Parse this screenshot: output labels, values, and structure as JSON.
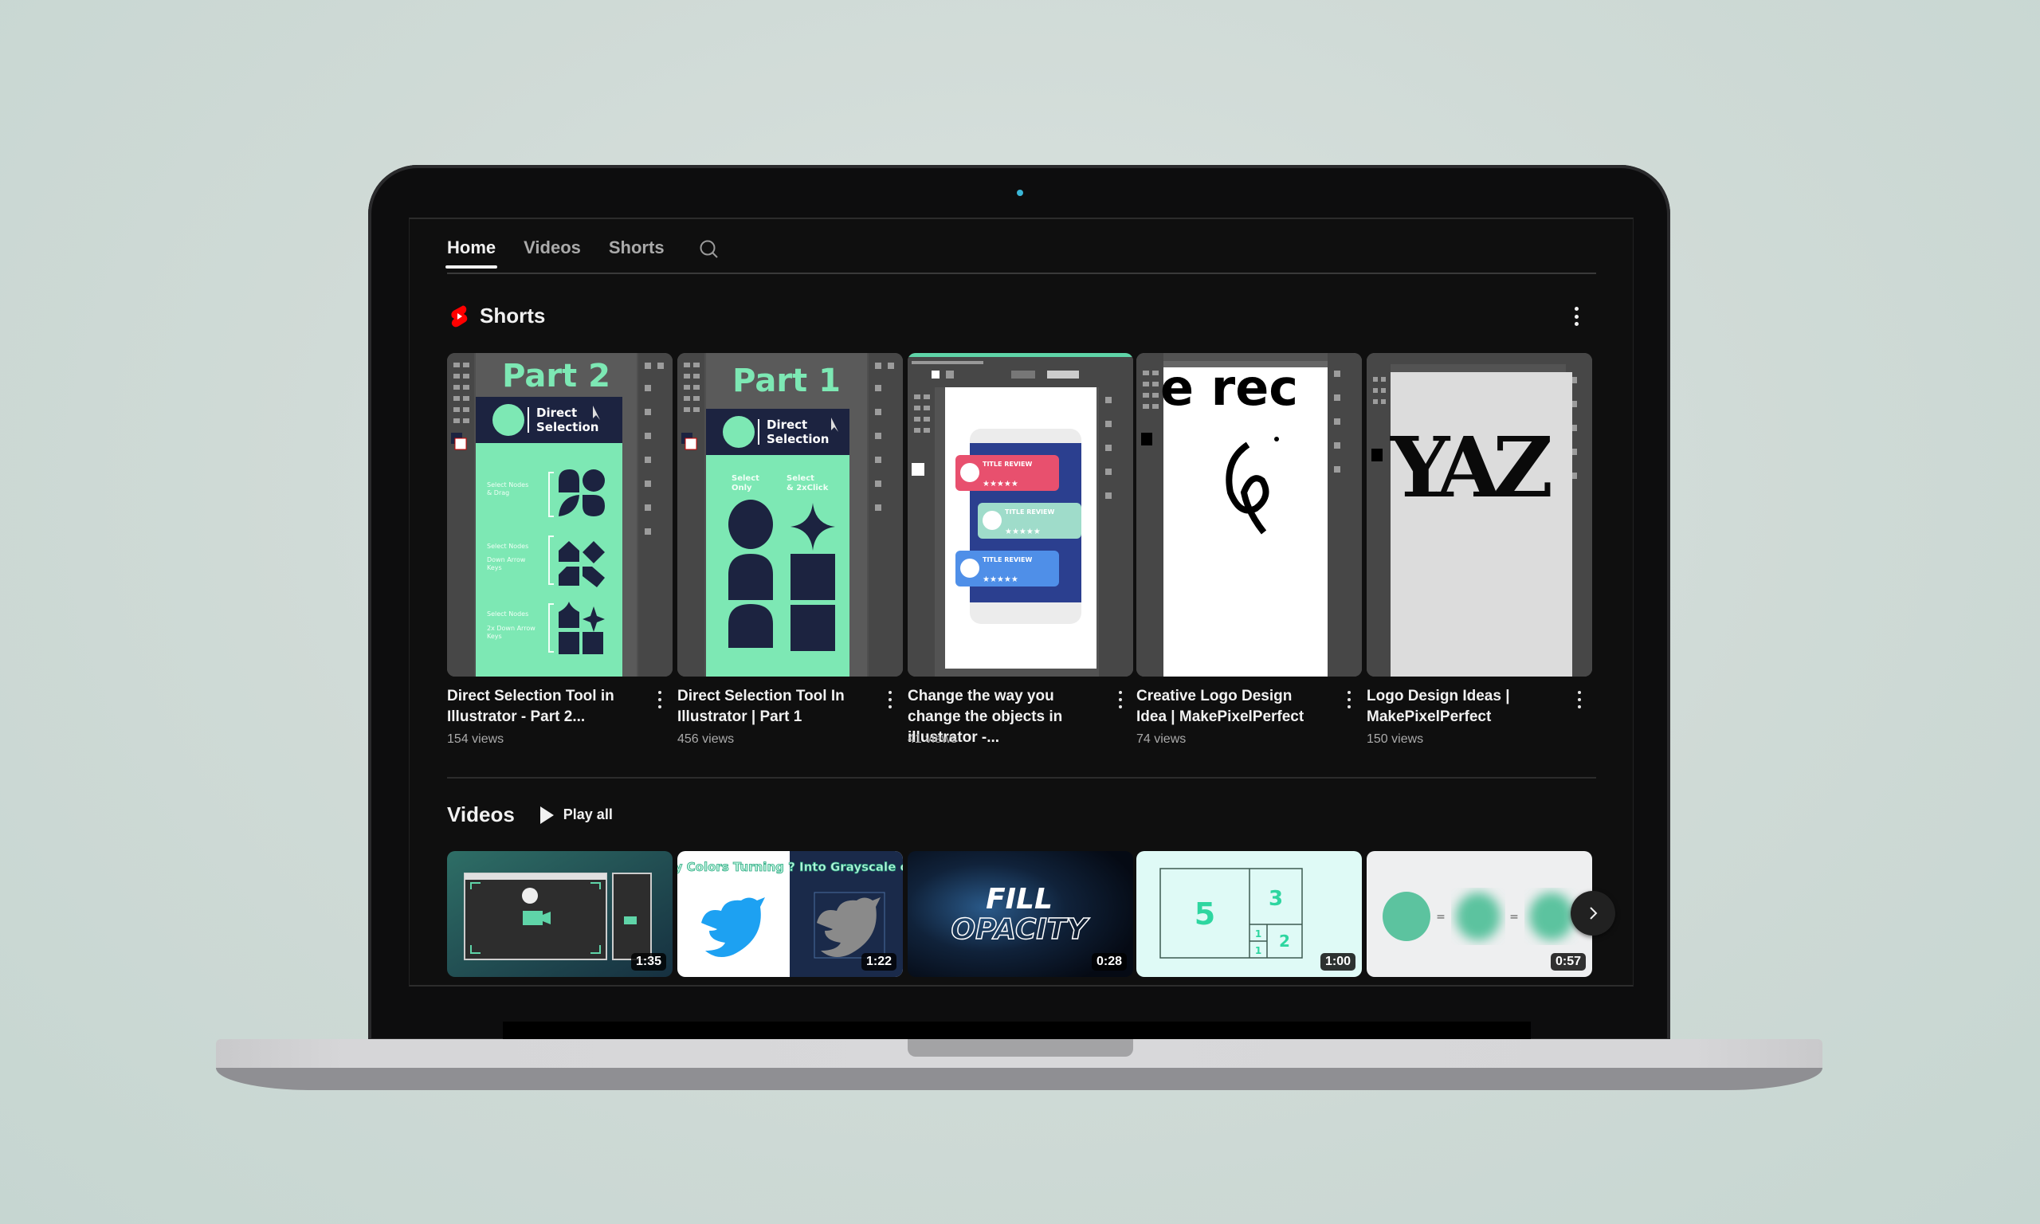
{
  "nav": {
    "tabs": [
      {
        "label": "Home",
        "active": true
      },
      {
        "label": "Videos",
        "active": false
      },
      {
        "label": "Shorts",
        "active": false
      }
    ],
    "search_icon": "search-icon"
  },
  "shorts_section": {
    "title": "Shorts",
    "icon": "youtube-shorts-icon",
    "accent": "#ff0000",
    "items": [
      {
        "title": "Direct Selection Tool in Illustrator - Part 2...",
        "views": "154 views",
        "thumb_text": "Part 2",
        "thumb_sub": "Direct Selection"
      },
      {
        "title": "Direct Selection Tool In Illustrator | Part 1",
        "views": "456 views",
        "thumb_text": "Part 1",
        "thumb_sub": "Direct Selection"
      },
      {
        "title": "Change the way you change the objects in illustrator -...",
        "views": "41 views",
        "thumb_text": "TITLE REVIEW"
      },
      {
        "title": "Creative Logo Design Idea | MakePixelPerfect",
        "views": "74 views",
        "thumb_text": "e   rec"
      },
      {
        "title": "Logo Design Ideas | MakePixelPerfect",
        "views": "150 views",
        "thumb_text": "YAZ"
      }
    ]
  },
  "videos_section": {
    "title": "Videos",
    "play_all_label": "Play all",
    "items": [
      {
        "duration": "1:35"
      },
      {
        "duration": "1:22",
        "thumb_text": "Why Colors Turning ? Into Grayscale colors"
      },
      {
        "duration": "0:28",
        "thumb_text_1": "FILL",
        "thumb_text_2": "OPACITY"
      },
      {
        "duration": "1:00",
        "thumb_numbers": [
          "5",
          "3",
          "1",
          "1",
          "2"
        ]
      },
      {
        "duration": "0:57",
        "thumb_symbols": [
          "=",
          "="
        ]
      }
    ]
  },
  "colors": {
    "screen_bg": "#0f0f0f",
    "text_primary": "#f1f1f1",
    "text_secondary": "#aaaaaa",
    "mint": "#7de8b4",
    "navy": "#1c2340"
  }
}
